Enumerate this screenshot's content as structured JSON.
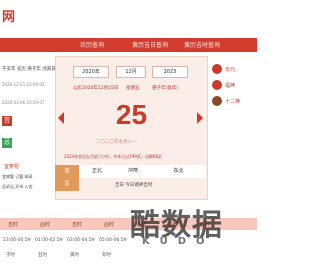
{
  "site": {
    "logo": "网"
  },
  "nav": {
    "items": [
      "农历查询",
      "黄历吉日查询",
      "黄历吉时查询"
    ]
  },
  "left": {
    "line1": "干支年  农历  庚子年  戊寅日",
    "line2": "2020-12-21 23:00:02",
    "line3": "2020-01-06 16:29:07",
    "tag1": "宜",
    "tag2": "忌",
    "line4": "宜祭祀",
    "line5": "宜嫁娶 订盟 纳采",
    "line6": "忌诉讼 开市 入宅"
  },
  "center": {
    "year": "2020年",
    "month": "12月",
    "day_sel": "2023",
    "gregorian": "公历2020年12月25日",
    "weekday": "星期五",
    "lunar_hint": "庚子年(鼠年)",
    "day": "25",
    "lunar_day": "二〇二〇年冬月十一",
    "festival_line": "2024年农历五月初六(节)，今年已过199天，还剩96天",
    "grid": [
      [
        "宜",
        "正北",
        "冲煞",
        "东北"
      ],
      [
        "忌",
        "喜神",
        "冲马 煞北",
        "财神"
      ]
    ],
    "grid_foot": "吉日 今日诸神吉时"
  },
  "right": {
    "items": [
      "日元",
      "福神",
      "十二神"
    ]
  },
  "table": {
    "headers": [
      "吉时",
      "凶时",
      "吉时",
      "凶时",
      "吉时",
      "凶时",
      "吉时"
    ],
    "row1": [
      "23:00-00:59",
      "01:00-02:59",
      "03:00-04:59",
      "05:00-06:59",
      "07:00-08:59",
      "09:00-10:59"
    ],
    "row2": [
      "子时",
      "丑时",
      "寅时",
      "卯时",
      "辰时",
      "巳时"
    ]
  },
  "watermark": {
    "title": "酷数据",
    "sub": "KUDO"
  },
  "colors": {
    "accent": "#d13c2e",
    "soft": "#fbeee8",
    "header": "#f7c9bd"
  }
}
